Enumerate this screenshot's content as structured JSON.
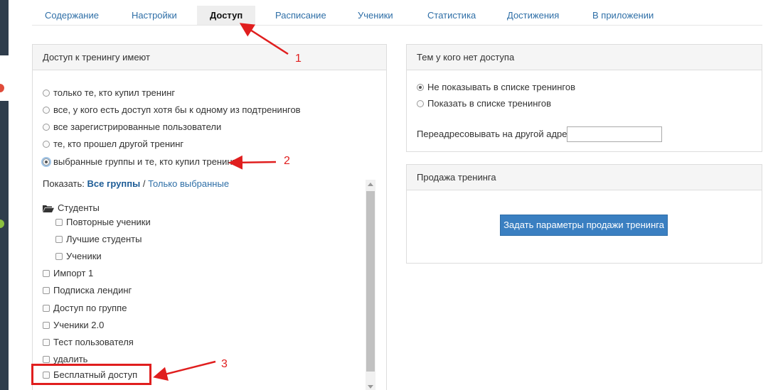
{
  "tabs": [
    {
      "label": "Содержание"
    },
    {
      "label": "Настройки"
    },
    {
      "label": "Доступ",
      "active": true
    },
    {
      "label": "Расписание"
    },
    {
      "label": "Ученики"
    },
    {
      "label": "Статистика"
    },
    {
      "label": "Достижения"
    },
    {
      "label": "В приложении"
    }
  ],
  "access_panel": {
    "title": "Доступ к тренингу имеют",
    "options": [
      {
        "label": "только те, кто купил тренинг",
        "checked": false
      },
      {
        "label": "все, у кого есть доступ хотя бы к одному из подтренингов",
        "checked": false
      },
      {
        "label": "все зарегистрированные пользователи",
        "checked": false
      },
      {
        "label": "те, кто прошел другой тренинг",
        "checked": false
      },
      {
        "label": "выбранные группы и те, кто купил тренинг",
        "checked": true
      }
    ],
    "show_label": "Показать:",
    "show_all": "Все группы",
    "show_sep": "/",
    "show_selected": "Только выбранные",
    "folder": "Студенты",
    "subgroups": [
      "Повторные ученики",
      "Лучшие студенты",
      "Ученики"
    ],
    "groups": [
      "Импорт 1",
      "Подписка лендинг",
      "Доступ по группе",
      "Ученики 2.0",
      "Тест пользователя",
      "удалить",
      "Бесплатный доступ"
    ]
  },
  "no_access_panel": {
    "title": "Тем у кого нет доступа",
    "options": [
      {
        "label": "Не показывать в списке тренингов",
        "checked": true
      },
      {
        "label": "Показать в списке тренингов",
        "checked": false
      }
    ],
    "redirect_label": "Переадресовывать на другой адрес",
    "redirect_value": ""
  },
  "sale_panel": {
    "title": "Продажа тренинга",
    "button_label": "Задать параметры продажи тренинга"
  },
  "annotations": [
    "1",
    "2",
    "3"
  ],
  "colors": {
    "accent": "#2f6fa7",
    "button": "#3a7fc1",
    "annotation": "#e01e1e",
    "sidebar": "#2f3d4c"
  }
}
